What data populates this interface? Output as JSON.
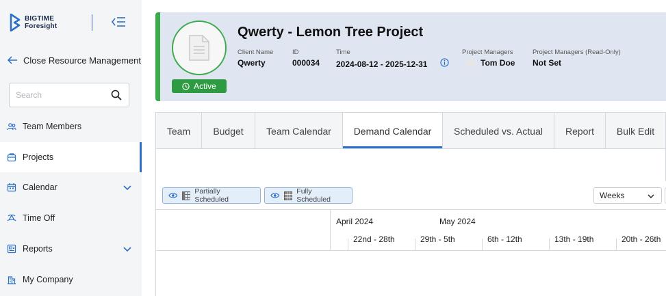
{
  "sidebar": {
    "logo": {
      "line1": "BIGTIME",
      "line2": "Foresight"
    },
    "close_resource_management": "Close Resource Management",
    "search_placeholder": "Search",
    "items": [
      {
        "label": "Team Members",
        "icon": "team-icon",
        "expandable": false,
        "active": false
      },
      {
        "label": "Projects",
        "icon": "projects-icon",
        "expandable": false,
        "active": true
      },
      {
        "label": "Calendar",
        "icon": "calendar-icon",
        "expandable": true,
        "active": false
      },
      {
        "label": "Time Off",
        "icon": "time-off-icon",
        "expandable": false,
        "active": false
      },
      {
        "label": "Reports",
        "icon": "reports-icon",
        "expandable": true,
        "active": false
      },
      {
        "label": "My Company",
        "icon": "company-icon",
        "expandable": false,
        "active": false
      }
    ]
  },
  "project": {
    "title": "Qwerty - Lemon Tree Project",
    "status": "Active",
    "fields": {
      "client_name_label": "Client Name",
      "client_name": "Qwerty",
      "id_label": "ID",
      "id": "000034",
      "time_label": "Time",
      "time": "2024-08-12 - 2025-12-31",
      "pm_label": "Project Managers",
      "pm": "Tom Doe",
      "pm_ro_label": "Project Managers (Read-Only)",
      "pm_ro": "Not Set"
    }
  },
  "tabs": [
    {
      "label": "Team",
      "active": false
    },
    {
      "label": "Budget",
      "active": false
    },
    {
      "label": "Team Calendar",
      "active": false
    },
    {
      "label": "Demand Calendar",
      "active": true
    },
    {
      "label": "Scheduled vs. Actual",
      "active": false
    },
    {
      "label": "Report",
      "active": false
    },
    {
      "label": "Bulk Edit",
      "active": false
    }
  ],
  "toolbar": {
    "partially_scheduled": "Partially Scheduled",
    "fully_scheduled": "Fully Scheduled",
    "view_select": "Weeks"
  },
  "calendar": {
    "months": [
      "April 2024",
      "May 2024"
    ],
    "weeks": [
      "22nd - 28th",
      "29th - 5th",
      "6th - 12th",
      "13th - 19th",
      "20th - 26th"
    ]
  },
  "colors": {
    "accent_blue": "#2b6fc6",
    "active_green": "#2e9a41",
    "header_bg": "#dfe6f1",
    "sidebar_bg": "#f4f5f7"
  }
}
